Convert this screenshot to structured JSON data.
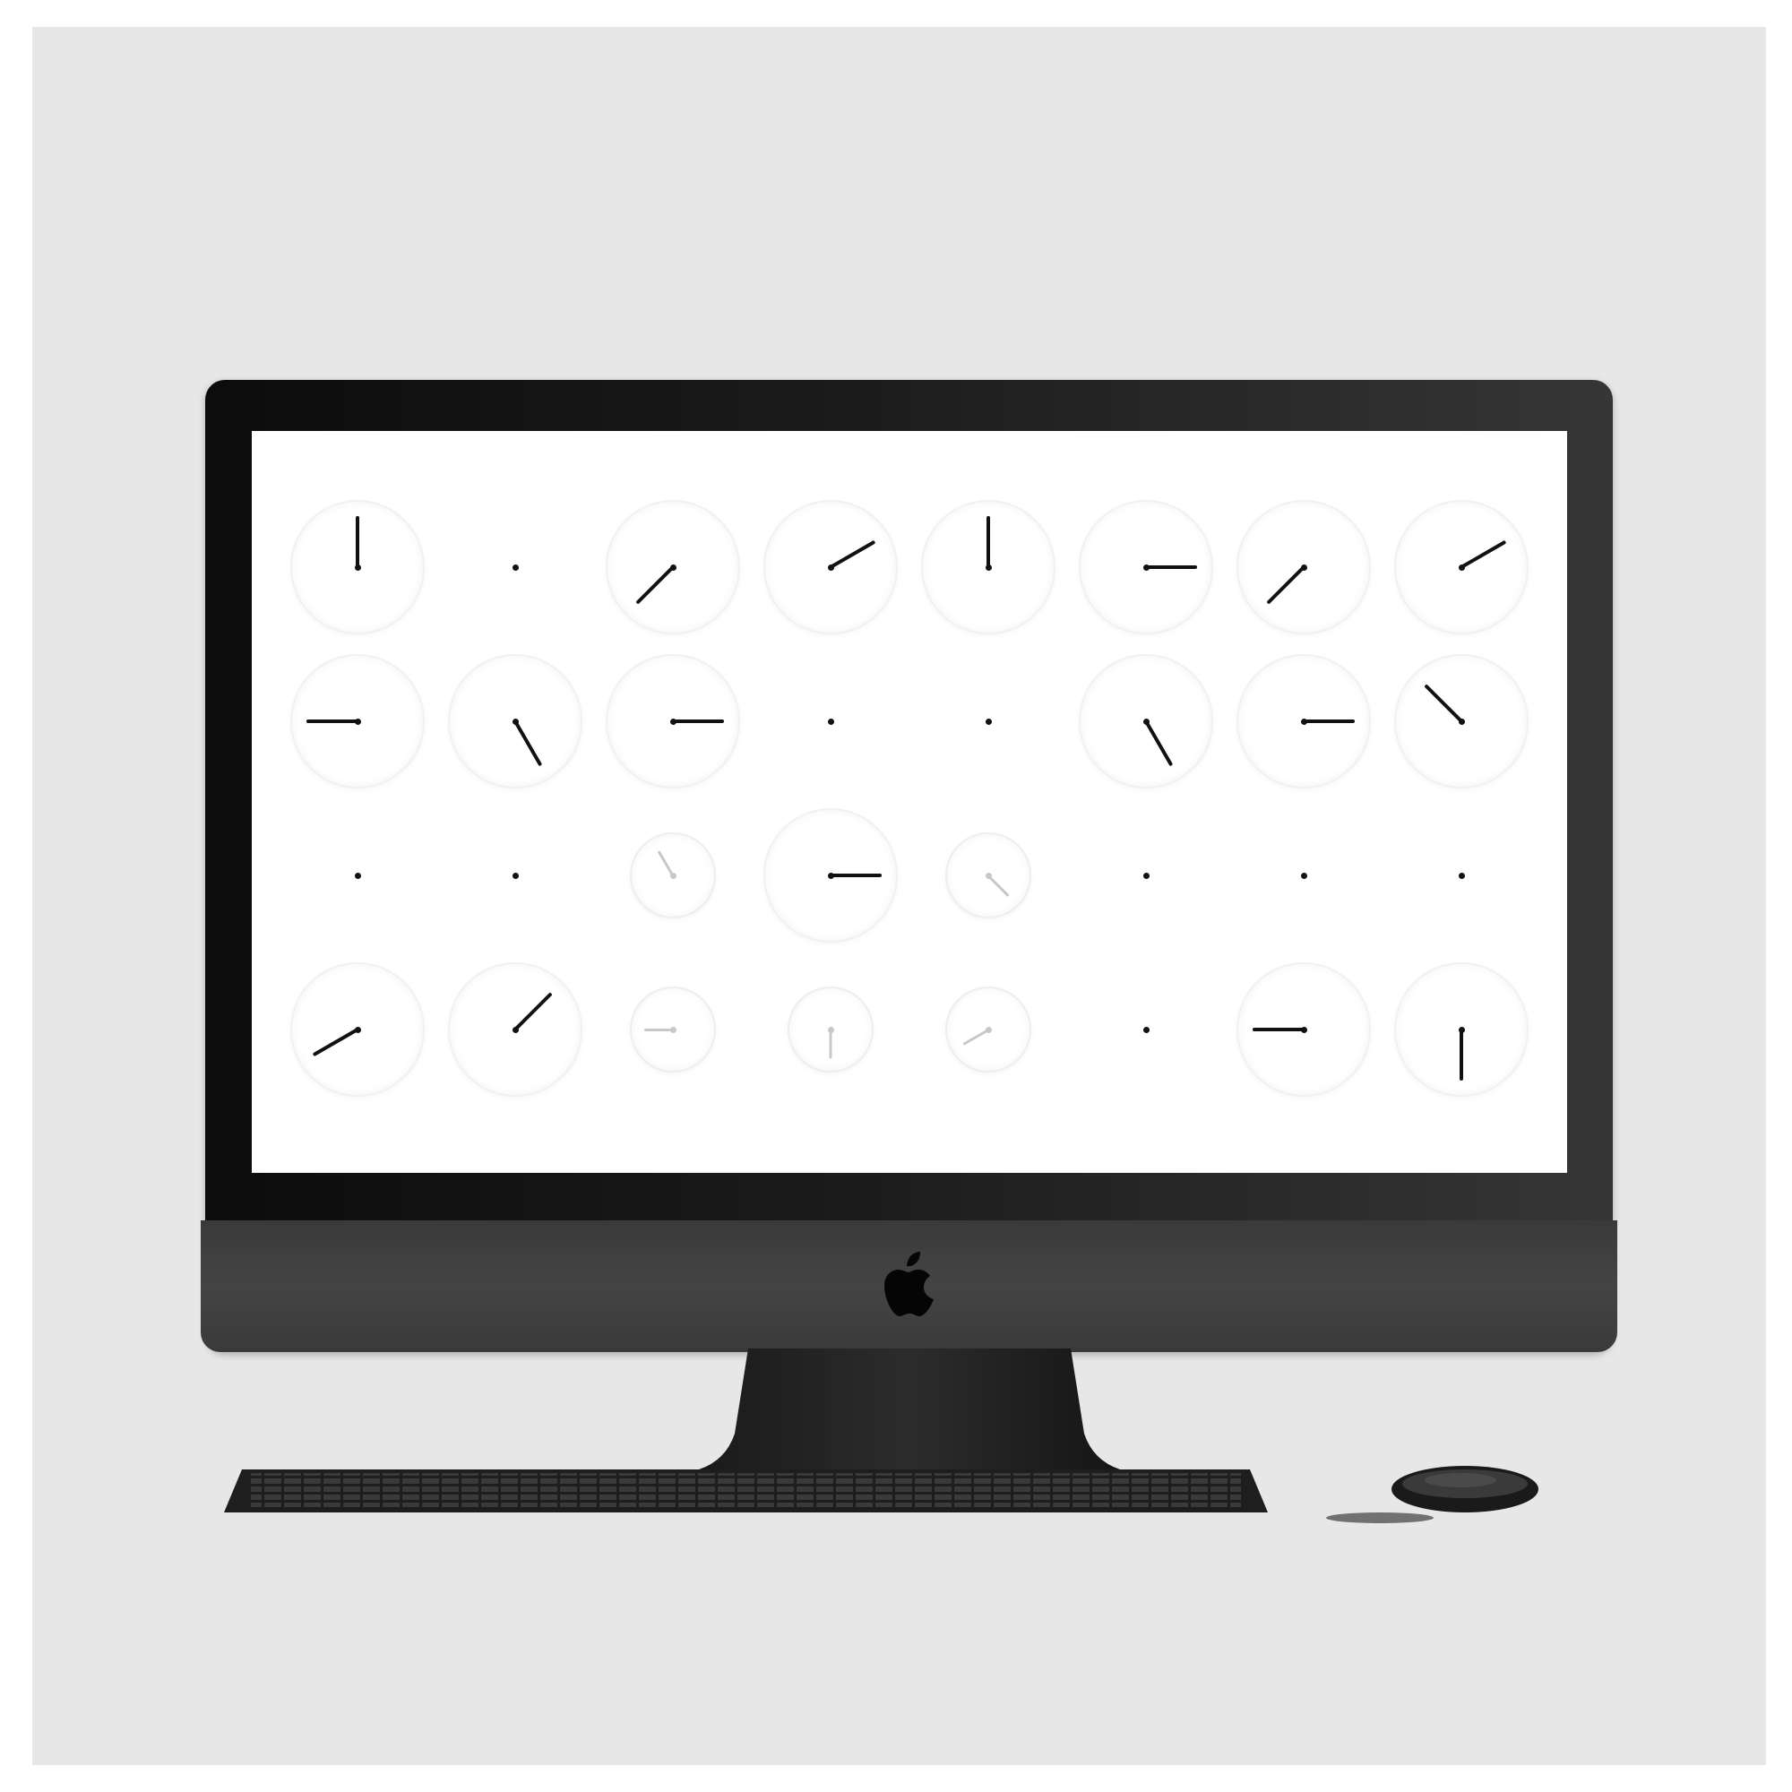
{
  "device": {
    "type": "desktop-monitor",
    "bezel_color": "#1b1b1b",
    "screen_background": "#ffffff",
    "backdrop_color": "#e7e7e7",
    "logo_icon": "apple-logo-icon"
  },
  "screen": {
    "app": "clock-grid-screensaver",
    "rows": 4,
    "columns": 8,
    "hand_color": "#111111",
    "faded_hand_color": "#c8c8c8",
    "clocks": [
      {
        "row": 1,
        "col": 1,
        "face": "large",
        "hand_angle_deg": 0,
        "hand_opacity": 1
      },
      {
        "row": 1,
        "col": 2,
        "face": "none",
        "hand_angle_deg": null,
        "hand_opacity": 1
      },
      {
        "row": 1,
        "col": 3,
        "face": "large",
        "hand_angle_deg": 225,
        "hand_opacity": 1
      },
      {
        "row": 1,
        "col": 4,
        "face": "large",
        "hand_angle_deg": 60,
        "hand_opacity": 1
      },
      {
        "row": 1,
        "col": 5,
        "face": "large",
        "hand_angle_deg": 0,
        "hand_opacity": 1
      },
      {
        "row": 1,
        "col": 6,
        "face": "large",
        "hand_angle_deg": 90,
        "hand_opacity": 1
      },
      {
        "row": 1,
        "col": 7,
        "face": "large",
        "hand_angle_deg": 225,
        "hand_opacity": 1
      },
      {
        "row": 1,
        "col": 8,
        "face": "large",
        "hand_angle_deg": 60,
        "hand_opacity": 1
      },
      {
        "row": 2,
        "col": 1,
        "face": "large",
        "hand_angle_deg": 270,
        "hand_opacity": 1
      },
      {
        "row": 2,
        "col": 2,
        "face": "large",
        "hand_angle_deg": 150,
        "hand_opacity": 1
      },
      {
        "row": 2,
        "col": 3,
        "face": "large",
        "hand_angle_deg": 90,
        "hand_opacity": 1
      },
      {
        "row": 2,
        "col": 4,
        "face": "none",
        "hand_angle_deg": null,
        "hand_opacity": 1
      },
      {
        "row": 2,
        "col": 5,
        "face": "none",
        "hand_angle_deg": null,
        "hand_opacity": 1
      },
      {
        "row": 2,
        "col": 6,
        "face": "large",
        "hand_angle_deg": 150,
        "hand_opacity": 1
      },
      {
        "row": 2,
        "col": 7,
        "face": "large",
        "hand_angle_deg": 90,
        "hand_opacity": 1
      },
      {
        "row": 2,
        "col": 8,
        "face": "large",
        "hand_angle_deg": 315,
        "hand_opacity": 1
      },
      {
        "row": 3,
        "col": 1,
        "face": "none",
        "hand_angle_deg": null,
        "hand_opacity": 1
      },
      {
        "row": 3,
        "col": 2,
        "face": "none",
        "hand_angle_deg": null,
        "hand_opacity": 1
      },
      {
        "row": 3,
        "col": 3,
        "face": "small",
        "hand_angle_deg": 330,
        "hand_opacity": 0.25
      },
      {
        "row": 3,
        "col": 4,
        "face": "large",
        "hand_angle_deg": 90,
        "hand_opacity": 1
      },
      {
        "row": 3,
        "col": 5,
        "face": "small",
        "hand_angle_deg": 135,
        "hand_opacity": 0.25
      },
      {
        "row": 3,
        "col": 6,
        "face": "none",
        "hand_angle_deg": null,
        "hand_opacity": 1
      },
      {
        "row": 3,
        "col": 7,
        "face": "none",
        "hand_angle_deg": null,
        "hand_opacity": 1
      },
      {
        "row": 3,
        "col": 8,
        "face": "none",
        "hand_angle_deg": null,
        "hand_opacity": 1
      },
      {
        "row": 4,
        "col": 1,
        "face": "large",
        "hand_angle_deg": 240,
        "hand_opacity": 1
      },
      {
        "row": 4,
        "col": 2,
        "face": "large",
        "hand_angle_deg": 45,
        "hand_opacity": 1
      },
      {
        "row": 4,
        "col": 3,
        "face": "small",
        "hand_angle_deg": 270,
        "hand_opacity": 0.25
      },
      {
        "row": 4,
        "col": 4,
        "face": "small",
        "hand_angle_deg": 180,
        "hand_opacity": 0.25
      },
      {
        "row": 4,
        "col": 5,
        "face": "small",
        "hand_angle_deg": 240,
        "hand_opacity": 0.25
      },
      {
        "row": 4,
        "col": 6,
        "face": "none",
        "hand_angle_deg": null,
        "hand_opacity": 1
      },
      {
        "row": 4,
        "col": 7,
        "face": "large",
        "hand_angle_deg": 270,
        "hand_opacity": 1
      },
      {
        "row": 4,
        "col": 8,
        "face": "large",
        "hand_angle_deg": 180,
        "hand_opacity": 1
      }
    ]
  },
  "peripherals": {
    "keyboard_icon": "keyboard-icon",
    "mouse_icon": "mouse-icon",
    "peripheral_color": "#2a2a2a"
  }
}
